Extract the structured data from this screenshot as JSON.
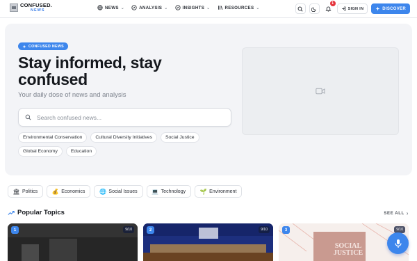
{
  "brand": {
    "name": "CONFUSED.",
    "sub": "NEWS"
  },
  "nav": [
    {
      "label": "NEWS",
      "icon": "globe-icon"
    },
    {
      "label": "ANALYSIS",
      "icon": "compass-icon"
    },
    {
      "label": "INSIGHTS",
      "icon": "compass-icon"
    },
    {
      "label": "RESOURCES",
      "icon": "library-icon"
    }
  ],
  "header": {
    "notifications_count": "1",
    "signin_label": "SIGN IN",
    "discover_label": "DISCOVER"
  },
  "hero": {
    "badge": "CONFUSED NEWS",
    "title": "Stay informed, stay confused",
    "subtitle": "Your daily dose of news and analysis",
    "search_placeholder": "Search confused news...",
    "tags": [
      "Environmental Conservation",
      "Cultural Diversity Initiatives",
      "Social Justice",
      "Global Economy",
      "Education"
    ]
  },
  "categories": [
    {
      "label": "Politics",
      "emoji": "🏛"
    },
    {
      "label": "Economics",
      "emoji": "💰"
    },
    {
      "label": "Social Issues",
      "emoji": "🌐"
    },
    {
      "label": "Technology",
      "emoji": "💻"
    },
    {
      "label": "Environment",
      "emoji": "🌱"
    }
  ],
  "popular": {
    "title": "Popular Topics",
    "see_all": "SEE ALL",
    "cards": [
      {
        "rank": "1",
        "score": "9/10"
      },
      {
        "rank": "2",
        "score": "9/10"
      },
      {
        "rank": "3",
        "score": "9/10",
        "image_text": "SOCIAL JUSTICE"
      }
    ]
  },
  "colors": {
    "accent": "#3d86ec",
    "badge_red": "#e5343c"
  }
}
